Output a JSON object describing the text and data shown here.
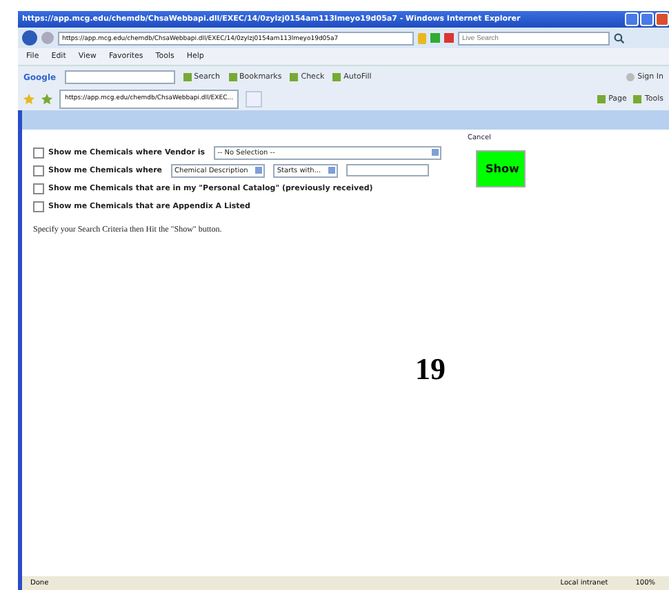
{
  "window": {
    "title": "https://app.mcg.edu/chemdb/ChsaWebbapi.dll/EXEC/14/0zylzj0154am113lmeyo19d05a7 - Windows Internet Explorer"
  },
  "address_bar": {
    "url": "https://app.mcg.edu/chemdb/ChsaWebbapi.dll/EXEC/14/0zylzj0154am113lmeyo19d05a7"
  },
  "search_box": {
    "placeholder": "Live Search"
  },
  "menu": [
    "File",
    "Edit",
    "View",
    "Favorites",
    "Tools",
    "Help"
  ],
  "google_toolbar": {
    "label": "Google",
    "items": [
      "Search",
      "Bookmarks",
      "Check",
      "AutoFill"
    ],
    "sign_in": "Sign In"
  },
  "tab": {
    "title": "https://app.mcg.edu/chemdb/ChsaWebbapi.dll/EXEC..."
  },
  "command_bar": [
    "Page",
    "Tools"
  ],
  "page": {
    "cancel": "Cancel",
    "options": [
      {
        "kind": "vendor",
        "checked": false,
        "label": "Show me Chemicals where Vendor is",
        "select": "-- No Selection --"
      },
      {
        "kind": "field",
        "checked": false,
        "label": "Show me Chemicals where",
        "selects": [
          "Chemical Description",
          "Starts with..."
        ]
      },
      {
        "kind": "plain",
        "checked": false,
        "label": "Show me Chemicals that are in my \"Personal Catalog\" (previously received)"
      },
      {
        "kind": "plain",
        "checked": false,
        "label": "Show me Chemicals that are Appendix A Listed"
      }
    ],
    "show_button": "Show",
    "instruction": "Specify your Search Criteria then Hit the \"Show\" button.",
    "page_number": "19"
  },
  "status_bar": {
    "status": "Done",
    "zone": "Local intranet",
    "zoom": "100%"
  }
}
